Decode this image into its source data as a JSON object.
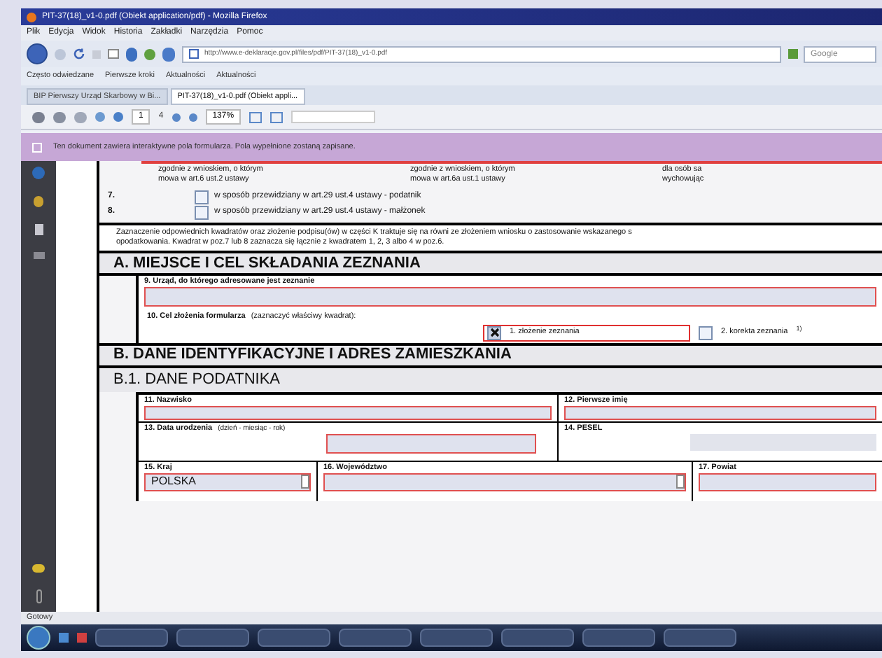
{
  "window": {
    "title": "PIT-37(18)_v1-0.pdf (Obiekt application/pdf) - Mozilla Firefox"
  },
  "menu": [
    "Plik",
    "Edycja",
    "Widok",
    "Historia",
    "Zakładki",
    "Narzędzia",
    "Pomoc"
  ],
  "address_bar": {
    "value": "http://www.e-deklaracje.gov.pl/files/pdf/PIT-37(18)_v1-0.pdf"
  },
  "search": {
    "placeholder": "Google"
  },
  "bookmarks": [
    "Często odwiedzane",
    "Pierwsze kroki",
    "Aktualności",
    "Aktualności"
  ],
  "tabs": [
    {
      "label": "BIP Pierwszy Urząd Skarbowy w Bi...",
      "selected": false
    },
    {
      "label": "PIT-37(18)_v1-0.pdf (Obiekt appli...",
      "selected": true
    }
  ],
  "pdf_toolbar": {
    "page": "1",
    "pages": "4",
    "zoom": "137%"
  },
  "notification": "Ten dokument zawiera interaktywne pola formularza. Pola wypełnione zostaną zapisane.",
  "form": {
    "row6": [
      [
        "zgodnie z wnioskiem, o którym",
        "mowa w art.6 ust.2 ustawy"
      ],
      [
        "zgodnie z wnioskiem, o którym",
        "mowa w art.6a ust.1 ustawy"
      ],
      [
        "dla osób sa",
        "wychowując"
      ]
    ],
    "options": [
      {
        "number": "7.",
        "label": "w sposób przewidziany w art.29 ust.4 ustawy - podatnik",
        "checked": false
      },
      {
        "number": "8.",
        "label": "w sposób przewidziany w art.29 ust.4 ustawy - małżonek",
        "checked": false
      }
    ],
    "note": [
      "Zaznaczenie odpowiednich kwadratów oraz złożenie podpisu(ów) w części K traktuje się na równi ze złożeniem wniosku o zastosowanie wskazanego s",
      "opodatkowania. Kwadrat w poz.7 lub 8 zaznacza się łącznie z kwadratem 1, 2, 3 albo 4 w poz.6."
    ],
    "section_a": "A. MIEJSCE I CEL SKŁADANIA ZEZNANIA",
    "field9": "9. Urząd, do którego adresowane jest zeznanie",
    "field10": {
      "label": "10. Cel złożenia formularza",
      "hint": "(zaznaczyć właściwy kwadrat):"
    },
    "purposes": [
      {
        "label": "1. złożenie zeznania",
        "checked": true
      },
      {
        "label": "2. korekta zeznania",
        "mark": "1)",
        "checked": false
      }
    ],
    "section_b": "B. DANE IDENTYFIKACYJNE I ADRES ZAMIESZKANIA",
    "section_b1": "B.1. DANE PODATNIKA",
    "fields": {
      "surname": "11. Nazwisko",
      "first_name": "12. Pierwsze imię",
      "birth": "13. Data urodzenia",
      "birth_hint": "(dzień - miesiąc - rok)",
      "pesel": "14. PESEL",
      "country": "15. Kraj",
      "country_value": "POLSKA",
      "province": "16. Województwo",
      "district": "17. Powiat"
    }
  },
  "status_bar": "Gotowy"
}
